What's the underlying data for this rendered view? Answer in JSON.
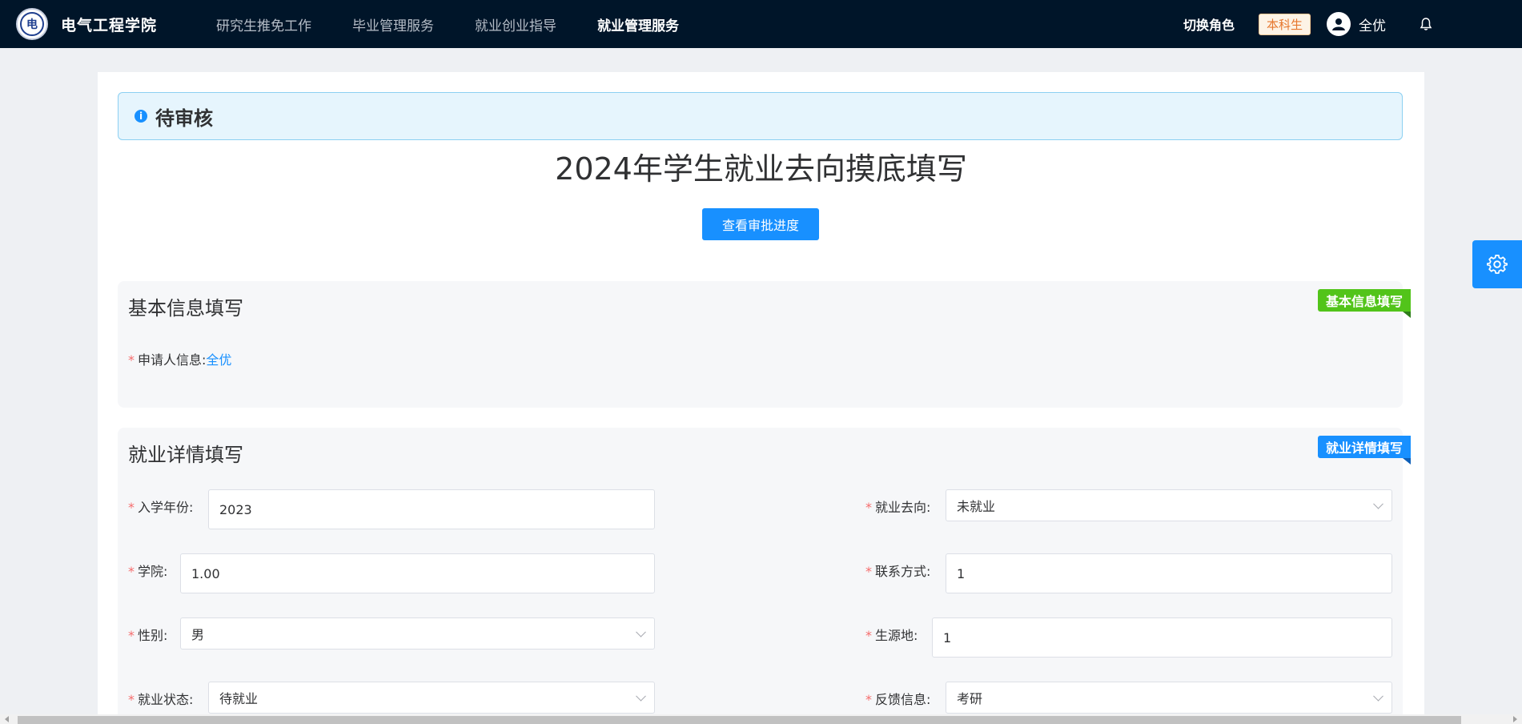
{
  "header": {
    "brand": "电气工程学院",
    "logo_text": "电",
    "nav": [
      {
        "label": "研究生推免工作",
        "active": false
      },
      {
        "label": "毕业管理服务",
        "active": false
      },
      {
        "label": "就业创业指导",
        "active": false
      },
      {
        "label": "就业管理服务",
        "active": true
      }
    ],
    "switch_role": "切换角色",
    "role_badge": "本科生",
    "user_name": "全优"
  },
  "alert": {
    "text": "待审核",
    "icon": "info-icon"
  },
  "page_title": "2024年学生就业去向摸底填写",
  "progress_button": "查看审批进度",
  "section_basic": {
    "title": "基本信息填写",
    "ribbon": "基本信息填写",
    "applicant_label": "申请人信息:",
    "applicant_value": "全优"
  },
  "section_detail": {
    "title": "就业详情填写",
    "ribbon": "就业详情填写",
    "fields": {
      "enroll_year": {
        "label": "入学年份:",
        "value": "2023"
      },
      "destination": {
        "label": "就业去向:",
        "value": "未就业"
      },
      "college": {
        "label": "学院:",
        "value": "1.00"
      },
      "contact": {
        "label": "联系方式:",
        "value": "1"
      },
      "gender": {
        "label": "性别:",
        "value": "男"
      },
      "origin": {
        "label": "生源地:",
        "value": "1"
      },
      "status": {
        "label": "就业状态:",
        "value": "待就业"
      },
      "feedback": {
        "label": "反馈信息:",
        "value": "考研"
      }
    }
  },
  "colors": {
    "navbar": "#001529",
    "primary": "#1890ff",
    "success": "#52c41a",
    "required": "#f56c6c"
  }
}
